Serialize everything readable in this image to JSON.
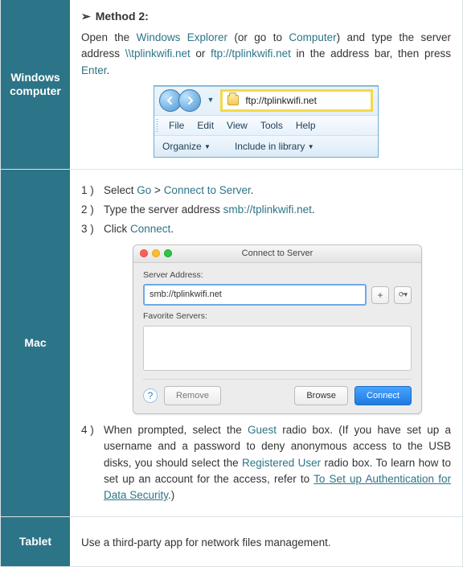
{
  "row1": {
    "label": "Windows computer",
    "method_title": "Method 2:",
    "text_a": "Open the ",
    "link_win_exp": "Windows Explorer",
    "text_b": " (or go to ",
    "link_computer": "Computer",
    "text_c": ") and type the server address ",
    "link_unc": "\\\\tplinkwifi.net",
    "text_d": " or ",
    "link_ftp": "ftp://tplinkwifi.net",
    "text_e": " in the address bar, then press ",
    "link_enter": "Enter",
    "text_f": "."
  },
  "win": {
    "addr": "ftp://tplinkwifi.net",
    "menu": {
      "file": "File",
      "edit": "Edit",
      "view": "View",
      "tools": "Tools",
      "help": "Help"
    },
    "organize": "Organize",
    "include": "Include in library"
  },
  "row2": {
    "label": "Mac",
    "s1a": "Select ",
    "s1_go": "Go",
    "s1b": " > ",
    "s1_cts": "Connect to Server",
    "s1c": ".",
    "s2a": "Type the server address ",
    "s2_smb": "smb://tplinkwifi.net",
    "s2b": ".",
    "s3a": "Click ",
    "s3_connect": "Connect",
    "s3b": ".",
    "s4a": "When prompted, select the ",
    "s4_guest": "Guest",
    "s4b": " radio box. (If you have set up a username and a password to deny anonymous access to the USB disks, you should select the ",
    "s4_reg": "Registered User",
    "s4c": " radio box. To learn how to set up an account for the access, refer to ",
    "s4_link": "To Set up Authentication for Data Security",
    "s4d": ".)"
  },
  "mac": {
    "title": "Connect to Server",
    "server_address": "Server Address:",
    "input": "smb://tplinkwifi.net",
    "plus": "+",
    "fav": "Favorite Servers:",
    "help": "?",
    "remove": "Remove",
    "browse": "Browse",
    "connect": "Connect"
  },
  "row3": {
    "label": "Tablet",
    "text": "Use a third-party app for network files management."
  },
  "nums": {
    "n1": "1 )",
    "n2": "2 )",
    "n3": "3 )",
    "n4": "4 )"
  }
}
